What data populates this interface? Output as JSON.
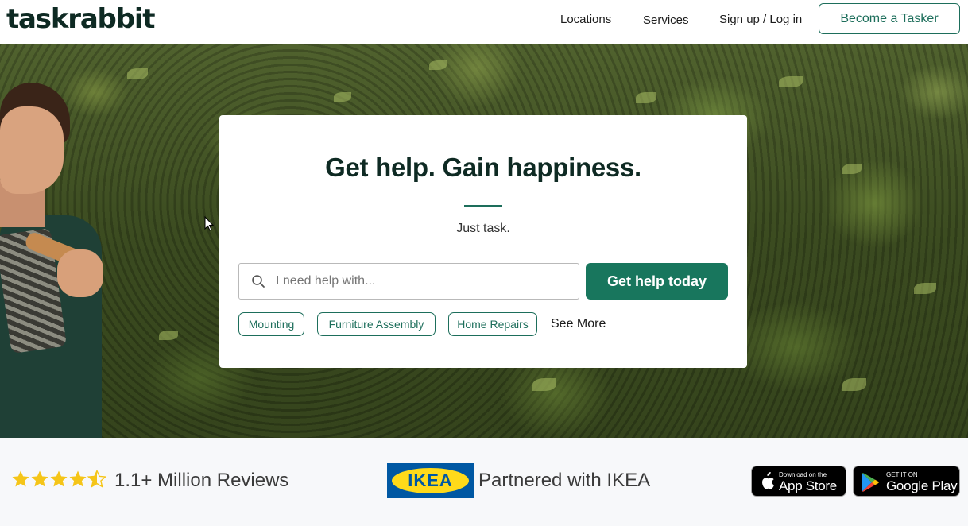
{
  "header": {
    "logo": "taskrabbit",
    "nav": {
      "locations": "Locations",
      "services": "Services",
      "signup": "Sign up / Log in"
    },
    "become_tasker": "Become a Tasker"
  },
  "hero": {
    "title": "Get help. Gain happiness.",
    "subtitle": "Just task.",
    "search": {
      "placeholder": "I need help with...",
      "value": ""
    },
    "cta": "Get help today",
    "chips": [
      "Mounting",
      "Furniture Assembly",
      "Home Repairs"
    ],
    "see_more": "See More"
  },
  "bottom": {
    "rating_stars": 4.5,
    "reviews": "1.1+ Million Reviews",
    "ikea_logo": "IKEA",
    "ikea_partner": "Partnered with IKEA",
    "app_store": {
      "small": "Download on the",
      "big": "App Store"
    },
    "google_play": {
      "small": "GET IT ON",
      "big": "Google Play"
    }
  },
  "colors": {
    "brand_green": "#18765d",
    "logo_dark": "#0e2a23",
    "star": "#f5c518",
    "ikea_blue": "#0058a3",
    "ikea_yellow": "#ffda1a"
  },
  "icons": {
    "search": "search-icon",
    "star": "star-icon",
    "apple": "apple-icon",
    "play": "google-play-icon"
  }
}
